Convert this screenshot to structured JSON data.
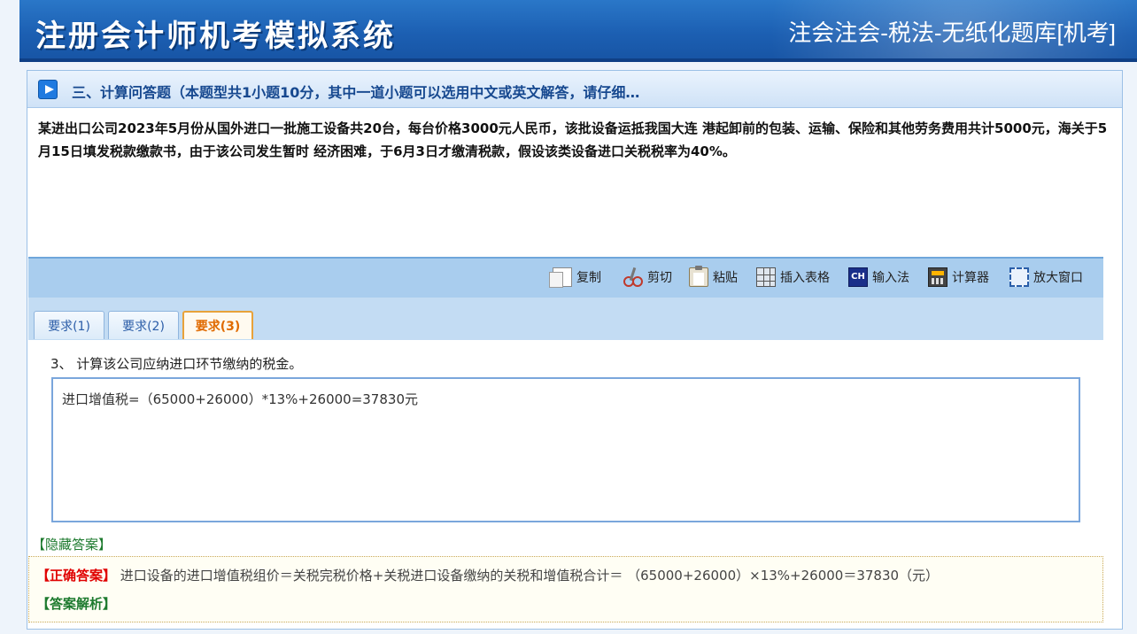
{
  "header": {
    "app_title": "注册会计师机考模拟系统",
    "exam_title": "注会注会-税法-无纸化题库[机考]"
  },
  "section": {
    "title": "三、计算问答题（本题型共1小题10分，其中一道小题可以选用中文或英文解答，请仔细…"
  },
  "question": {
    "text": "某进出口公司2023年5月份从国外进口一批施工设备共20台，每台价格3000元人民币，该批设备运抵我国大连 港起卸前的包装、运输、保险和其他劳务费用共计5000元，海关于5月15日填发税款缴款书，由于该公司发生暂时 经济困难，于6月3日才缴清税款，假设该类设备进口关税税率为40%。"
  },
  "toolbar": {
    "copy_label": "复制",
    "cut_label": "剪切",
    "paste_label": "粘贴",
    "insert_table_label": "插入表格",
    "ime_label": "输入法",
    "ime_icon_text": "CH",
    "calculator_label": "计算器",
    "maximize_label": "放大窗口"
  },
  "tabs": [
    {
      "label": "要求(1)",
      "active": false
    },
    {
      "label": "要求(2)",
      "active": false
    },
    {
      "label": "要求(3)",
      "active": true
    }
  ],
  "sub_question": {
    "text": "3、 计算该公司应纳进口环节缴纳的税金。"
  },
  "answer_input": {
    "value": "进口增值税=（65000+26000）*13%+26000=37830元"
  },
  "answer_panel": {
    "hide_link": "【隐藏答案】",
    "correct_label": "【正确答案】",
    "correct_text": " 进口设备的进口增值税组价＝关税完税价格+关税进口设备缴纳的关税和增值税合计＝ （65000+26000）×13%+26000＝37830（元）",
    "explain_label": "【答案解析】"
  },
  "colors": {
    "header_blue": "#1c5fb2",
    "active_tab": "#e06a00",
    "correct_red": "#e00000",
    "link_green": "#1d7a2e"
  }
}
